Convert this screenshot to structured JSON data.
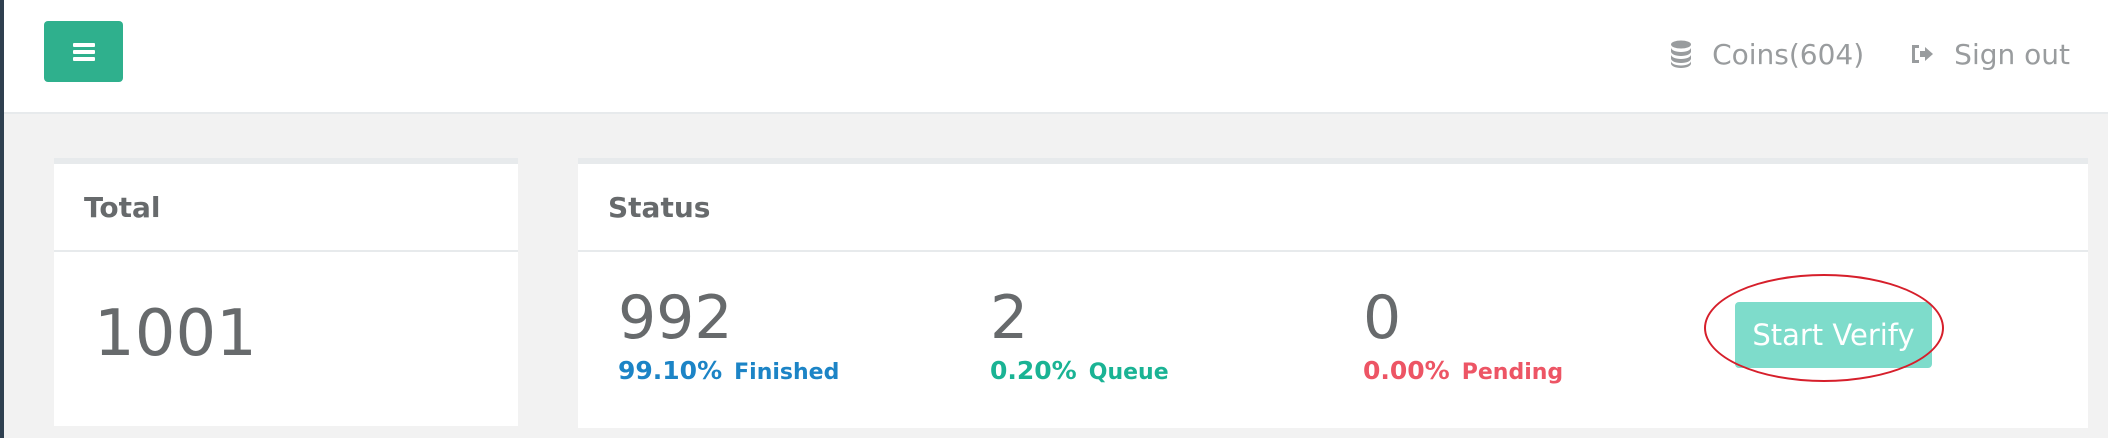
{
  "header": {
    "menu_icon": "hamburger-icon",
    "coins_icon": "database-stack-icon",
    "coins_label": "Coins(604)",
    "signout_icon": "sign-out-icon",
    "signout_label": "Sign out"
  },
  "total_panel": {
    "title": "Total",
    "value": "1001"
  },
  "status_panel": {
    "title": "Status",
    "stats": [
      {
        "value": "992",
        "percent": "99.10%",
        "label": "Finished",
        "color": "#1c84c6"
      },
      {
        "value": "2",
        "percent": "0.20%",
        "label": "Queue",
        "color": "#1ab394"
      },
      {
        "value": "0",
        "percent": "0.00%",
        "label": "Pending",
        "color": "#ed5565"
      }
    ],
    "action_label": "Start Verify"
  },
  "colors": {
    "accent": "#2fb08d",
    "button_light": "#7edccb",
    "highlight": "#d61f2b"
  }
}
